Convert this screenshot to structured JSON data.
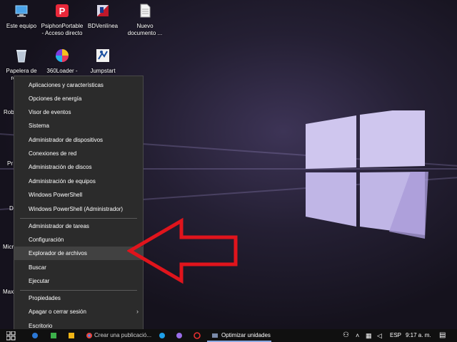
{
  "desktop": {
    "icons": [
      {
        "label": "Este equipo",
        "icon": "computer-icon"
      },
      {
        "label": "PsiphonPortable - Acceso directo",
        "icon": "psiphon-icon"
      },
      {
        "label": "BDVenlínea",
        "icon": "bdvenlinea-icon"
      },
      {
        "label": "Nuevo documento ...",
        "icon": "document-icon"
      },
      {
        "label": "Papelera de reciclaje",
        "icon": "recycle-bin-icon"
      },
      {
        "label": "360Loader - Acceso directo",
        "icon": "360loader-icon"
      },
      {
        "label": "Jumpstart",
        "icon": "jumpstart-icon"
      }
    ],
    "cut_labels": [
      "Rob",
      "Pr",
      "D",
      "Micr",
      "Max"
    ]
  },
  "context_menu": {
    "items": [
      "Aplicaciones y características",
      "Opciones de energía",
      "Visor de eventos",
      "Sistema",
      "Administrador de dispositivos",
      "Conexiones de red",
      "Administración de discos",
      "Administración de equipos",
      "Windows PowerShell",
      "Windows PowerShell (Administrador)",
      "Administrador de tareas",
      "Configuración",
      "Explorador de archivos",
      "Buscar",
      "Ejecutar",
      "Propiedades",
      "Apagar o cerrar sesión",
      "Escritorio"
    ],
    "highlighted": "Explorador de archivos",
    "submenu_arrow": "›"
  },
  "annotation": {
    "arrow_color": "#e0141c",
    "arrow_icon": "red-arrow-left"
  },
  "taskbar": {
    "task_1": "Crear una publicació...",
    "task_2": "Optimizar unidades",
    "language": "ESP",
    "time": "9:17 a. m."
  },
  "colors": {
    "menu_bg": "#2b2b2b",
    "menu_highlight": "#414141",
    "taskbar_bg": "#101010"
  }
}
